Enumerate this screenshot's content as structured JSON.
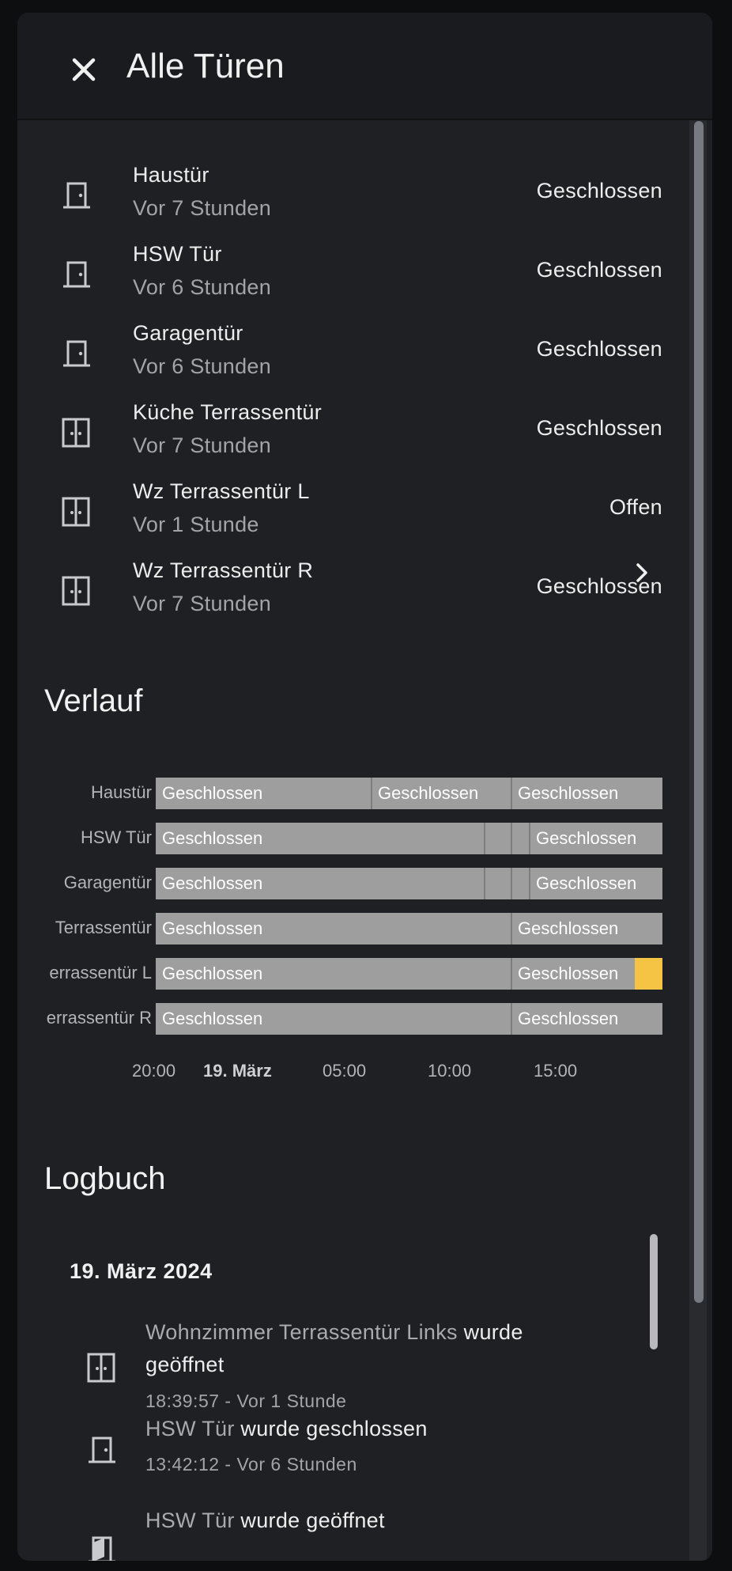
{
  "dialog": {
    "title": "Alle Türen"
  },
  "doors": [
    {
      "name": "Haustür",
      "time": "Vor 7 Stunden",
      "state": "Geschlossen",
      "icon": "door-closed-icon"
    },
    {
      "name": "HSW Tür",
      "time": "Vor 6 Stunden",
      "state": "Geschlossen",
      "icon": "door-closed-icon"
    },
    {
      "name": "Garagentür",
      "time": "Vor 6 Stunden",
      "state": "Geschlossen",
      "icon": "door-closed-icon"
    },
    {
      "name": "Küche Terrassentür",
      "time": "Vor 7 Stunden",
      "state": "Geschlossen",
      "icon": "double-door-icon"
    },
    {
      "name": "Wz Terrassentür L",
      "time": "Vor 1 Stunde",
      "state": "Offen",
      "icon": "double-door-icon"
    },
    {
      "name": "Wz Terrassentür R",
      "time": "Vor 7 Stunden",
      "state": "Geschlossen",
      "icon": "double-door-icon"
    }
  ],
  "history": {
    "title": "Verlauf",
    "rows": [
      {
        "label": "Haustür",
        "segments": [
          "Geschlossen",
          "Geschlossen",
          "Geschlossen"
        ]
      },
      {
        "label": "HSW Tür",
        "segments": [
          "Geschlossen",
          "Geschlossen"
        ]
      },
      {
        "label": "Garagentür",
        "segments": [
          "Geschlossen",
          "Geschlossen"
        ]
      },
      {
        "label": "Terrassentür",
        "segments": [
          "Geschlossen",
          "Geschlossen"
        ]
      },
      {
        "label": "errassentür L",
        "segments": [
          "Geschlossen",
          "Geschlossen"
        ]
      },
      {
        "label": "errassentür R",
        "segments": [
          "Geschlossen",
          "Geschlossen"
        ]
      }
    ],
    "ticks": [
      "20:00",
      "19. März",
      "05:00",
      "10:00",
      "15:00"
    ],
    "open_color": "#f6c445",
    "closed_color": "#9e9e9e"
  },
  "logbook": {
    "title": "Logbuch",
    "date": "19. März 2024",
    "entries": [
      {
        "entity": "Wohnzimmer Terrassentür Links",
        "action": "wurde geöffnet",
        "meta": "18:39:57 - Vor 1 Stunde"
      },
      {
        "entity": "HSW Tür",
        "action": "wurde geschlossen",
        "meta": "13:42:12 - Vor 6 Stunden"
      },
      {
        "entity": "HSW Tür",
        "action": "wurde geöffnet",
        "meta": ""
      }
    ]
  }
}
